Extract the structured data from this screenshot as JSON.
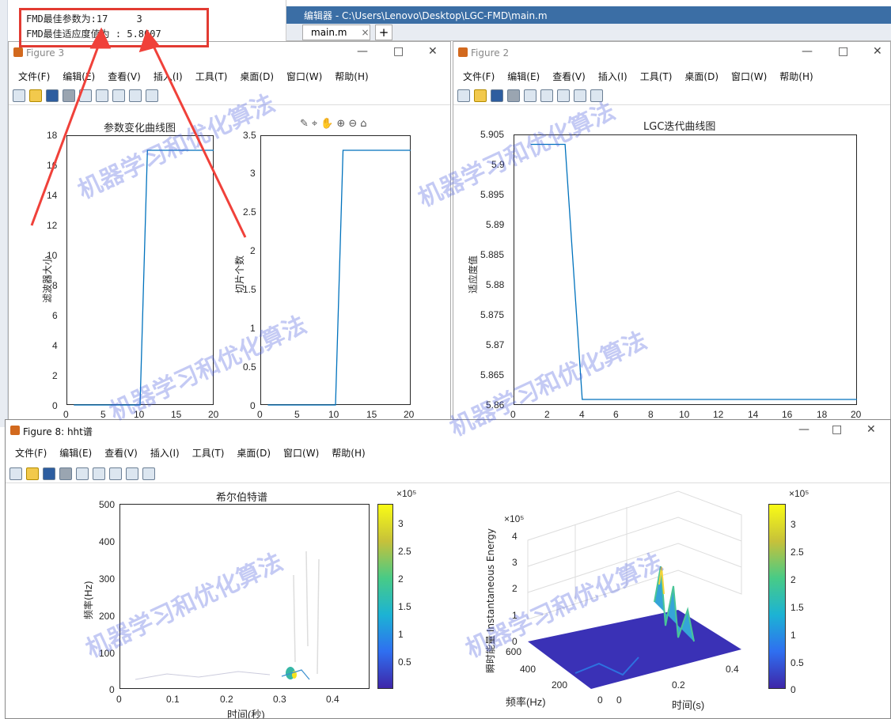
{
  "console": {
    "line1": "FMD最佳参数为:17     3",
    "line2": "FMD最佳适应度值为 : 5.8607"
  },
  "editor": {
    "title": "编辑器 - C:\\Users\\Lenovo\\Desktop\\LGC-FMD\\main.m",
    "tab": "main.m",
    "tab_close": "×",
    "tab_add": "+"
  },
  "menus": [
    "文件(F)",
    "编辑(E)",
    "查看(V)",
    "插入(I)",
    "工具(T)",
    "桌面(D)",
    "窗口(W)",
    "帮助(H)"
  ],
  "fig3": {
    "title": "Figure 3",
    "plot1": {
      "title": "参数变化曲线图",
      "ylabel": "滤波器大小",
      "yticks": [
        "18",
        "16",
        "14",
        "12",
        "10",
        "8",
        "6",
        "4",
        "2",
        "0"
      ],
      "xticks": [
        "0",
        "5",
        "10",
        "15",
        "20"
      ]
    },
    "plot2": {
      "ylabel": "切片个数",
      "yticks": [
        "3.5",
        "3",
        "2.5",
        "2",
        "1.5",
        "1",
        "0.5",
        "0"
      ],
      "xticks": [
        "0",
        "5",
        "10",
        "15",
        "20"
      ]
    }
  },
  "fig2": {
    "title": "Figure 2",
    "plot": {
      "title": "LGC迭代曲线图",
      "ylabel": "适应度值",
      "yticks": [
        "5.905",
        "5.9",
        "5.895",
        "5.89",
        "5.885",
        "5.88",
        "5.875",
        "5.87",
        "5.865",
        "5.86"
      ],
      "xticks": [
        "0",
        "2",
        "4",
        "6",
        "8",
        "10",
        "12",
        "14",
        "16",
        "18",
        "20"
      ]
    }
  },
  "fig8": {
    "title": "Figure 8: hht谱",
    "left": {
      "title": "希尔伯特谱",
      "ylabel": "频率(Hz)",
      "xlabel": "时间(秒)",
      "yticks": [
        "500",
        "400",
        "300",
        "200",
        "100",
        "0"
      ],
      "xticks": [
        "0",
        "0.1",
        "0.2",
        "0.3",
        "0.4"
      ],
      "cb_exp": "×10⁵",
      "cbticks": [
        "3",
        "2.5",
        "2",
        "1.5",
        "1",
        "0.5"
      ]
    },
    "right": {
      "zlabel": "瞬时能量 Instantaneous Energy",
      "zexp": "×10⁵",
      "zticks": [
        "4",
        "3",
        "2",
        "1",
        "0"
      ],
      "ylabel": "频率(Hz)",
      "xlabel": "时间(s)",
      "yticks": [
        "600",
        "400",
        "200",
        "0"
      ],
      "xticks": [
        "0",
        "0.2",
        "0.4"
      ],
      "cb_exp": "×10⁵",
      "cbticks": [
        "3",
        "2.5",
        "2",
        "1.5",
        "1",
        "0.5",
        "0"
      ]
    }
  },
  "chart_data": [
    {
      "type": "line",
      "title": "参数变化曲线图",
      "ylabel": "滤波器大小",
      "xlim": [
        0,
        20
      ],
      "ylim": [
        0,
        18
      ],
      "x": [
        1,
        10,
        11,
        20
      ],
      "values": [
        0,
        0,
        17,
        17
      ]
    },
    {
      "type": "line",
      "title": "",
      "ylabel": "切片个数",
      "xlim": [
        0,
        20
      ],
      "ylim": [
        0,
        3.5
      ],
      "x": [
        1,
        10,
        11,
        20
      ],
      "values": [
        0,
        0,
        3,
        3
      ]
    },
    {
      "type": "line",
      "title": "LGC迭代曲线图",
      "ylabel": "适应度值",
      "xlim": [
        0,
        20
      ],
      "ylim": [
        5.86,
        5.905
      ],
      "x": [
        1,
        2,
        3,
        4,
        5,
        6,
        8,
        10,
        12,
        14,
        16,
        18,
        20
      ],
      "values": [
        5.9031,
        5.9031,
        5.9031,
        5.8607,
        5.8607,
        5.8607,
        5.8607,
        5.8607,
        5.8607,
        5.8607,
        5.8607,
        5.8607,
        5.8607
      ]
    }
  ]
}
